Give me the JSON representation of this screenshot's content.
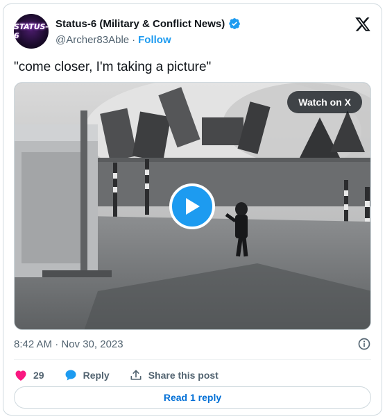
{
  "author": {
    "avatar_text": "STATUS-6",
    "display_name": "Status-6 (Military & Conflict News)",
    "handle": "@Archer83Able",
    "separator": "·",
    "follow_label": "Follow"
  },
  "tweet": {
    "text": "\"come closer, I'm taking a picture\"",
    "timestamp": "8:42 AM · Nov 30, 2023"
  },
  "media": {
    "watch_label": "Watch on X"
  },
  "actions": {
    "like_count": "29",
    "reply_label": "Reply",
    "share_label": "Share this post",
    "read_reply_label": "Read 1 reply"
  },
  "colors": {
    "accent": "#1d9bf0",
    "like": "#f91880",
    "read_reply": "#006fd6"
  },
  "icons": [
    "verified-badge-icon",
    "x-logo-icon",
    "play-icon",
    "info-icon",
    "heart-icon",
    "reply-bubble-icon",
    "share-icon"
  ]
}
